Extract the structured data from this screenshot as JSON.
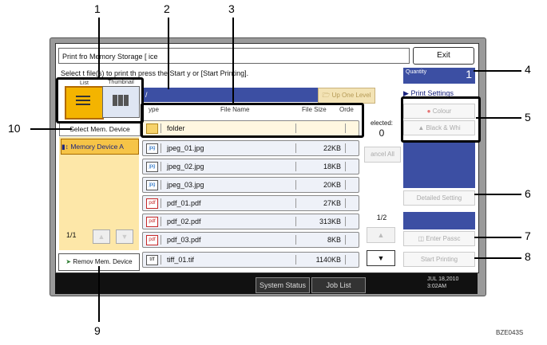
{
  "window": {
    "title": "Print fro   Memory Storage [   ice",
    "exit_label": "Exit",
    "instruction": "Select t   file(s) to print th   press the Start   y or [Start Printing]."
  },
  "view_tabs": {
    "list_label": "List",
    "thumbnail_label": "Thumbnail"
  },
  "left": {
    "select_label": "Select Mem. Device",
    "device_label": "Memory Device A",
    "page": "1/1",
    "up": "▲",
    "down": "▼",
    "remove_label": "Remov   Mem. Device"
  },
  "path": {
    "current": "/",
    "up_label": "Up One Level"
  },
  "columns": {
    "type": "ype",
    "name": "File Name",
    "size": "File Size",
    "order": "Orde"
  },
  "files": [
    {
      "icon": "folder",
      "name": "folder",
      "size": ""
    },
    {
      "icon": "jpg",
      "name": "jpeg_01.jpg",
      "size": "22KB"
    },
    {
      "icon": "jpg",
      "name": "jpeg_02.jpg",
      "size": "18KB"
    },
    {
      "icon": "jpg",
      "name": "jpeg_03.jpg",
      "size": "20KB"
    },
    {
      "icon": "pdf",
      "name": "pdf_01.pdf",
      "size": "27KB"
    },
    {
      "icon": "pdf",
      "name": "pdf_02.pdf",
      "size": "313KB"
    },
    {
      "icon": "pdf",
      "name": "pdf_03.pdf",
      "size": "8KB"
    },
    {
      "icon": "tiff",
      "name": "tiff_01.tif",
      "size": "1140KB"
    }
  ],
  "selection": {
    "label": "elected:",
    "count": "0",
    "cancel_label": "ancel All"
  },
  "list_pager": {
    "page": "1/2",
    "up": "▲",
    "down": "▼"
  },
  "right": {
    "quantity_label": "Quantity",
    "quantity_value": "1",
    "print_settings": "Print Settings",
    "colour": "Colour",
    "bw": "Black & Whi",
    "detailed": "Detailed Setting",
    "passcode": "Enter Passc",
    "start": "Start Printing"
  },
  "statusbar": {
    "system_status": "System Status",
    "job_list": "Job List",
    "date": "JUL  18,2010",
    "time": "3:02AM"
  },
  "callouts": [
    "1",
    "2",
    "3",
    "4",
    "5",
    "6",
    "7",
    "8",
    "9",
    "10"
  ],
  "figure_code": "BZE043S"
}
